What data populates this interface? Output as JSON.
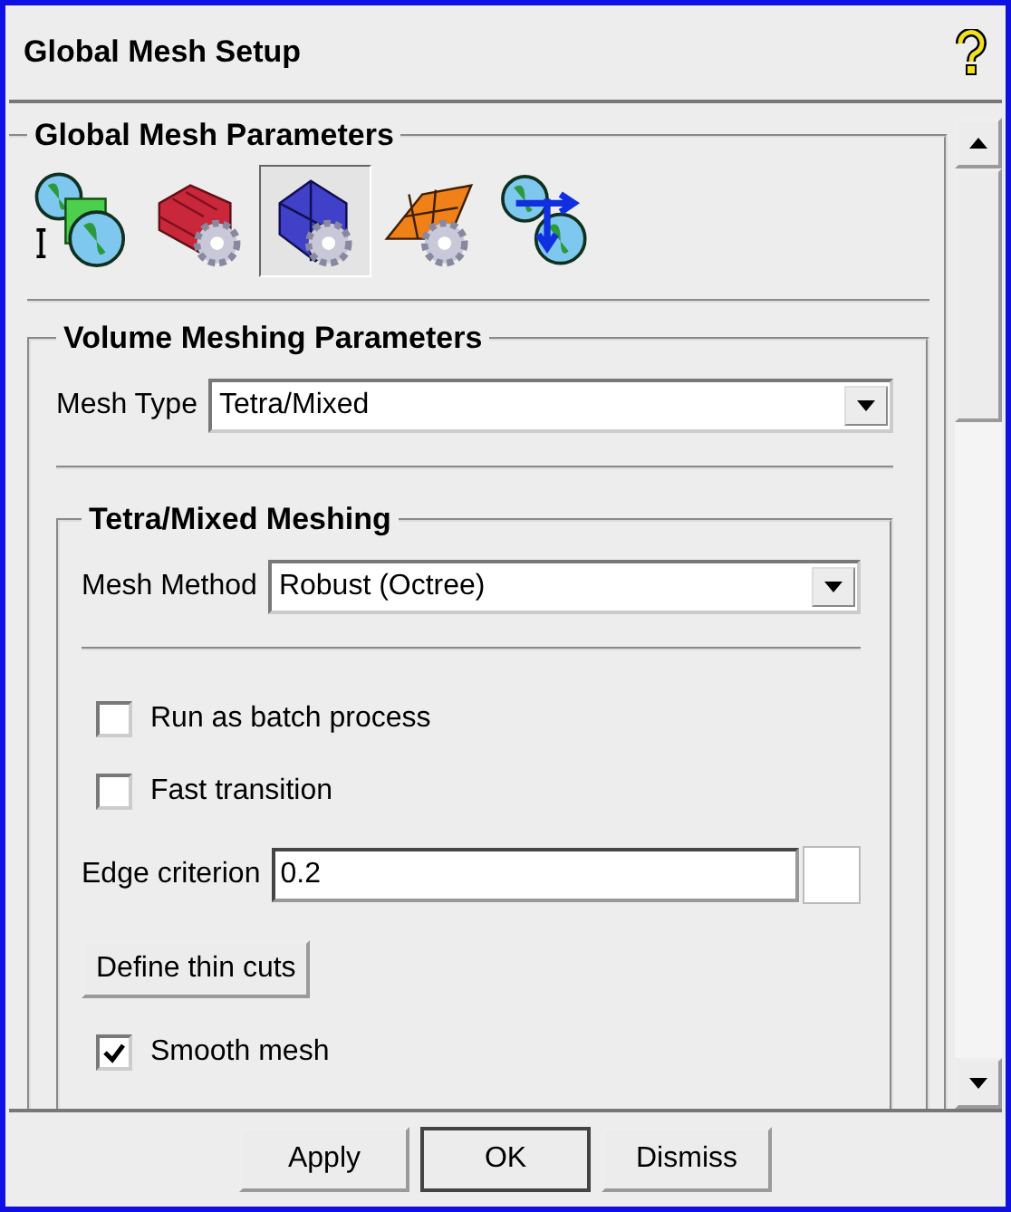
{
  "window": {
    "title": "Global Mesh Setup"
  },
  "global_mesh_parameters": {
    "title": "Global Mesh Parameters",
    "toolbar": [
      {
        "selected": false
      },
      {
        "selected": false
      },
      {
        "selected": true
      },
      {
        "selected": false
      },
      {
        "selected": false
      }
    ]
  },
  "volume_meshing_parameters": {
    "title": "Volume Meshing Parameters",
    "mesh_type": {
      "label": "Mesh Type",
      "value": "Tetra/Mixed"
    }
  },
  "tetra_mixed_meshing": {
    "title": "Tetra/Mixed Meshing",
    "mesh_method": {
      "label": "Mesh Method",
      "value": "Robust (Octree)"
    },
    "options": [
      {
        "kind": "checkbox",
        "label": "Run as batch process",
        "checked": false
      },
      {
        "kind": "checkbox",
        "label": "Fast transition",
        "checked": false
      },
      {
        "kind": "field",
        "label": "Edge criterion",
        "value": "0.2"
      },
      {
        "kind": "button",
        "label": "Define thin cuts"
      },
      {
        "kind": "checkbox",
        "label": "Smooth mesh",
        "checked": true
      }
    ]
  },
  "buttons": [
    {
      "label": "Apply",
      "default": false
    },
    {
      "label": "OK",
      "default": true
    },
    {
      "label": "Dismiss",
      "default": false
    }
  ]
}
